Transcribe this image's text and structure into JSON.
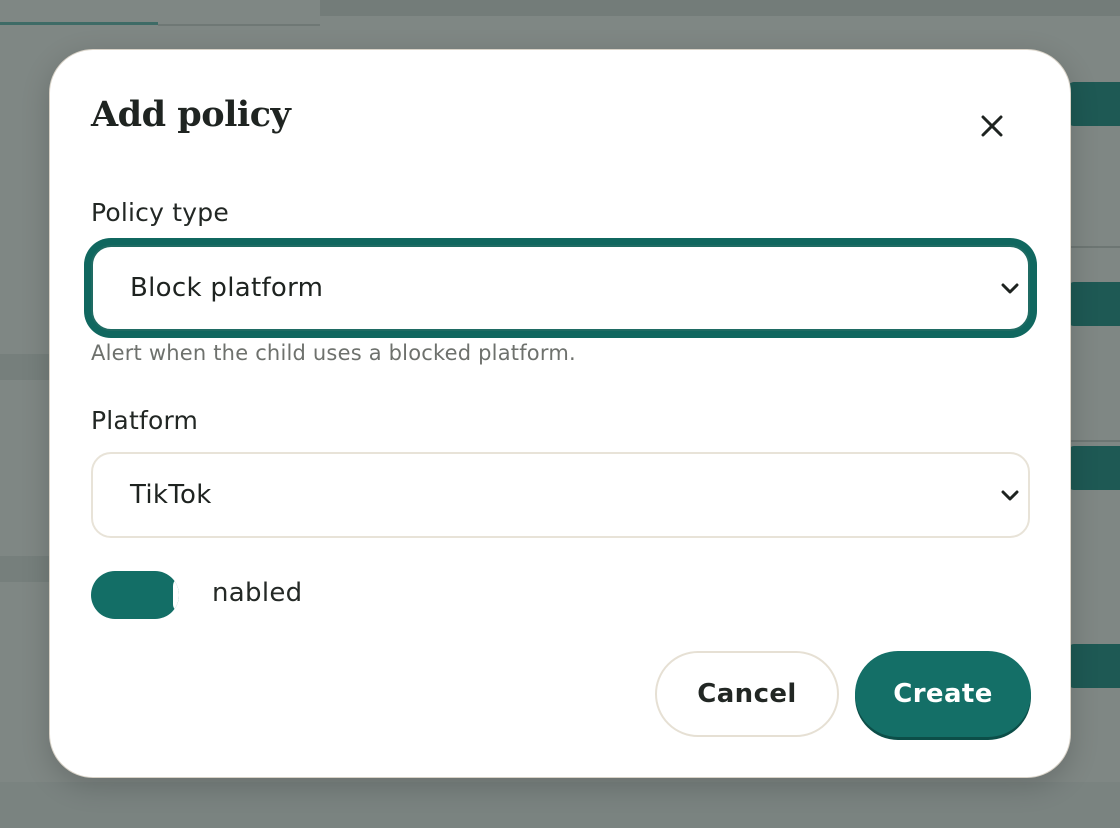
{
  "modal": {
    "title": "Add policy",
    "close_icon": "close-icon",
    "policy_type": {
      "label": "Policy type",
      "value": "Block platform",
      "help": "Alert when the child uses a blocked platform."
    },
    "platform": {
      "label": "Platform",
      "value": "TikTok"
    },
    "enabled_toggle": {
      "label": "nabled",
      "on": true
    },
    "actions": {
      "cancel_label": "Cancel",
      "create_label": "Create"
    }
  },
  "colors": {
    "accent": "#136e66",
    "focus_ring": "#10675f",
    "scrim": "#7f8784"
  }
}
